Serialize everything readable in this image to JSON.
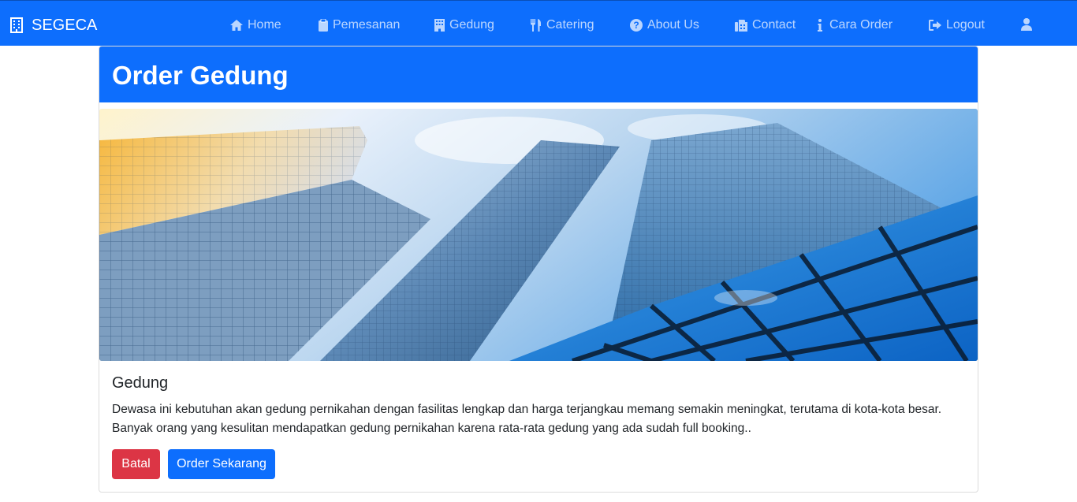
{
  "navbar": {
    "brand": "SEGECA",
    "brand_icon": "building-icon",
    "items": [
      {
        "label": "Home",
        "icon": "home-icon"
      },
      {
        "label": "Pemesanan",
        "icon": "clipboard-icon"
      },
      {
        "label": "Gedung",
        "icon": "building-icon"
      },
      {
        "label": "Catering",
        "icon": "utensils-icon"
      },
      {
        "label": "About Us",
        "icon": "question-circle-icon"
      },
      {
        "label": "Contact",
        "icon": "fax-icon"
      },
      {
        "label": "Cara Order",
        "icon": "info-icon"
      },
      {
        "label": "Logout",
        "icon": "sign-out-icon"
      }
    ],
    "user_icon": "user-icon"
  },
  "card": {
    "header_title": "Order Gedung",
    "image_subject": "glass skyscrapers viewed from below against a blue sky",
    "title": "Gedung",
    "text": "Dewasa ini kebutuhan akan gedung pernikahan dengan fasilitas lengkap dan harga terjangkau memang semakin meningkat, terutama di kota-kota besar. Banyak orang yang kesulitan mendapatkan gedung pernikahan karena rata-rata gedung yang ada sudah full booking..",
    "cancel_label": "Batal",
    "order_label": "Order Sekarang"
  },
  "colors": {
    "primary": "#0d6efd",
    "danger": "#dc3545"
  }
}
